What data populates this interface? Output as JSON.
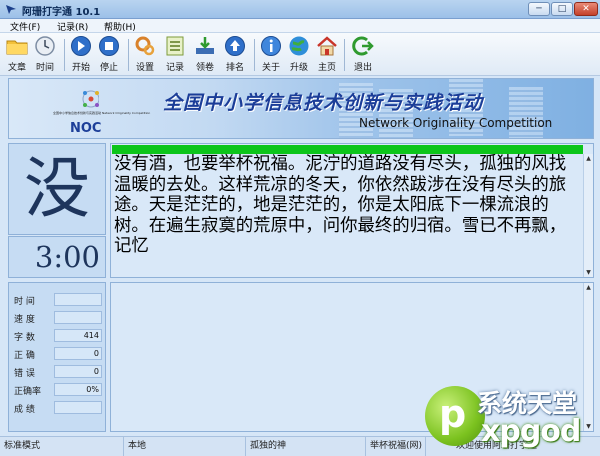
{
  "window": {
    "title": "阿珊打字通 10.1"
  },
  "menu": [
    "文件(F)",
    "记录(R)",
    "帮助(H)"
  ],
  "toolbar": {
    "file": "文章",
    "time": "时间",
    "start": "开始",
    "stop": "停止",
    "settings": "设置",
    "records": "记录",
    "exam": "领卷",
    "rank": "排名",
    "about": "关于",
    "upgrade": "升级",
    "home": "主页",
    "exit": "退出"
  },
  "banner": {
    "logo_text": "NOC",
    "logo_sub": "全国中小学信息技术创新与实践活动 Network Originality Competition",
    "title_cn": "全国中小学信息技术创新与实践活动",
    "title_en": "Network Originality Competition"
  },
  "current_char": "没",
  "timer": "3:00",
  "passage": "没有酒，也要举杯祝福。泥泞的道路没有尽头，孤独的风找温暖的去处。这样荒凉的冬天，你依然跋涉在没有尽头的旅途。天是茫茫的，地是茫茫的，你是太阳底下一棵流浪的树。在遍生寂寞的荒原中，问你最终的归宿。雪已不再飘，记忆",
  "progress_fraction": 1.0,
  "stats": [
    {
      "label": "时  间",
      "value": ""
    },
    {
      "label": "速  度",
      "value": ""
    },
    {
      "label": "字  数",
      "value": "414"
    },
    {
      "label": "正  确",
      "value": "0"
    },
    {
      "label": "错  误",
      "value": "0"
    },
    {
      "label": "正确率",
      "value": "0%"
    },
    {
      "label": "成  绩",
      "value": ""
    }
  ],
  "status": [
    "标准模式",
    "本地",
    "孤独的神",
    "举杯祝福(网)",
    "欢迎使用阿珊打字通"
  ],
  "watermark": {
    "cn": "系统天堂",
    "en": "xpgod",
    "p": "p"
  },
  "colors": {
    "progress": "#0cc51a",
    "accent": "#1b3d98",
    "panel": "#c6dcf3"
  }
}
